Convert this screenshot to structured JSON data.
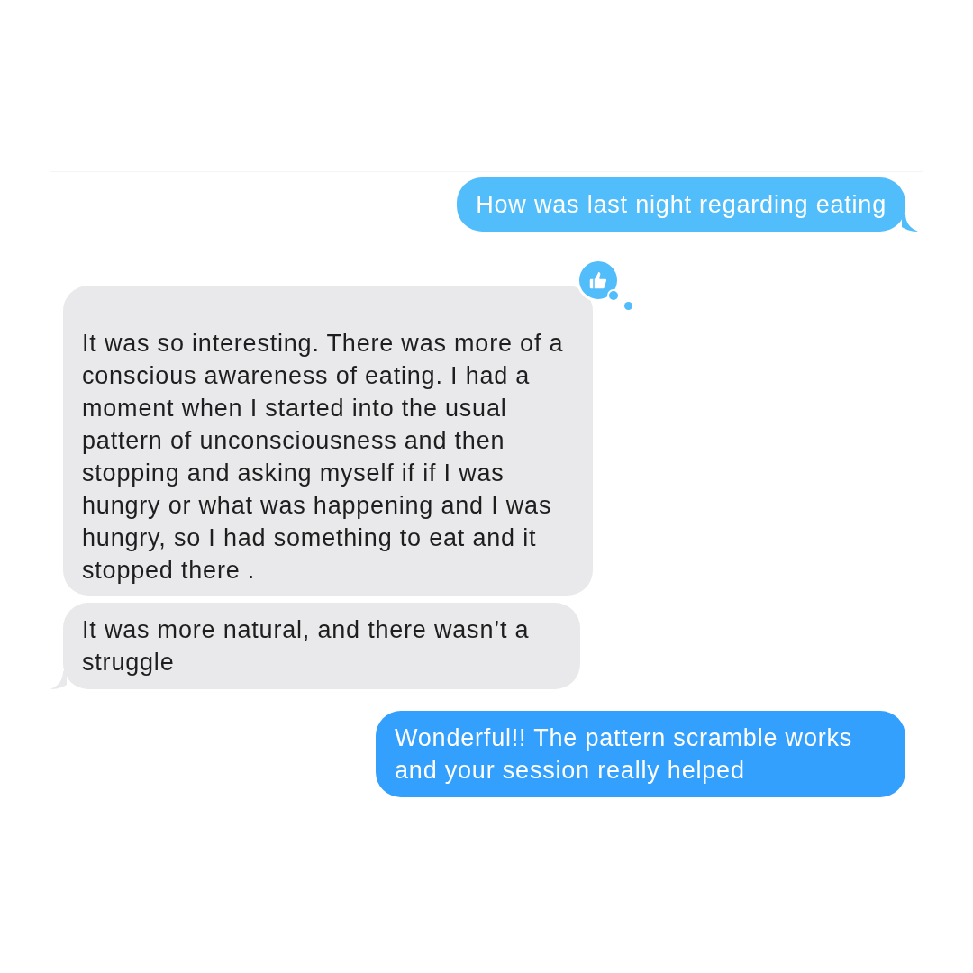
{
  "messages": [
    {
      "kind": "sent",
      "text": "How was last night regarding eating",
      "tail": true,
      "color": "#52bdfb"
    },
    {
      "kind": "received",
      "text": "It was so interesting. There was more of a conscious awareness of eating. I had a moment when I started into the usual pattern of unconsciousness and then stopping and asking myself if if I was hungry or what was happening and I was hungry, so I had something to eat and it stopped there .",
      "tail": false,
      "tapback": {
        "kind": "like"
      }
    },
    {
      "kind": "received",
      "text": "It was more natural, and there wasn’t a struggle",
      "tail": true
    },
    {
      "kind": "sent",
      "text": "Wonderful!! The pattern scramble works and your session really helped",
      "tail": false,
      "color": "#33a0fd"
    }
  ]
}
